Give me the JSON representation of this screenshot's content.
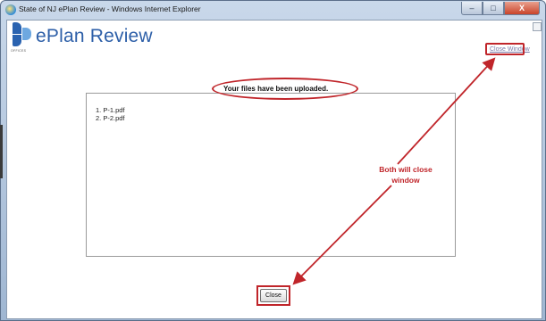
{
  "window": {
    "title": "State of NJ ePlan Review - Windows Internet Explorer",
    "buttons": {
      "minimize": "–",
      "maximize": "□",
      "close": "X"
    }
  },
  "header": {
    "app_name": "ePlan Review",
    "logo_caption": "OFFICES",
    "close_window_link": "Close Window"
  },
  "main": {
    "status_message": "Your files have been uploaded.",
    "files": [
      {
        "label": "1.  P-1.pdf"
      },
      {
        "label": "2.  P-2.pdf"
      }
    ],
    "close_button": "Close"
  },
  "annotation": {
    "line1": "Both will close",
    "line2": "window",
    "color": "#c0252a"
  }
}
